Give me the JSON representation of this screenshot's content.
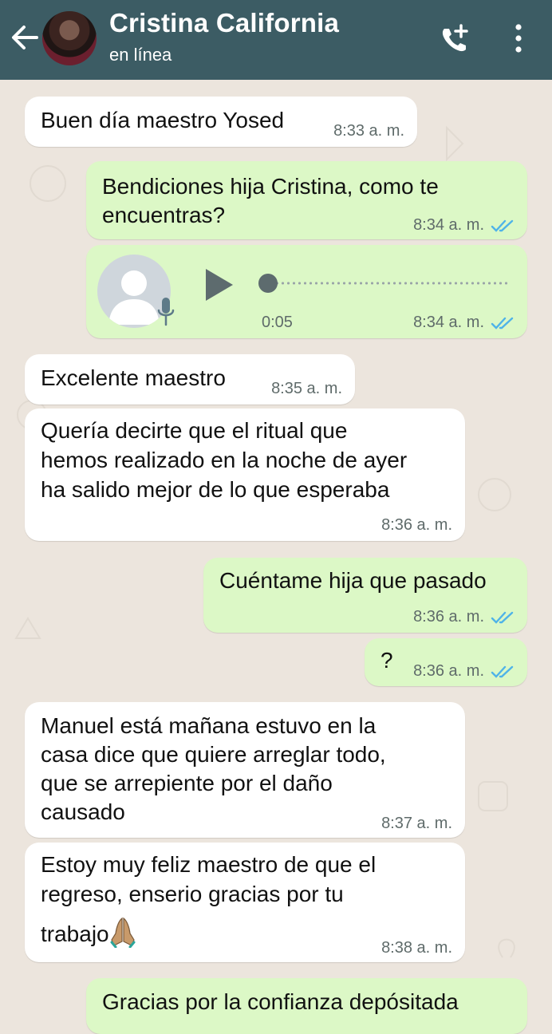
{
  "header": {
    "contact_name": "Cristina California",
    "status": "en línea",
    "background_color": "#3c5c64",
    "icons": [
      "back-arrow-icon",
      "add-call-icon",
      "more-options-icon"
    ]
  },
  "messages": [
    {
      "direction": "in",
      "text_lines": [
        "Buen día maestro Yosed"
      ],
      "time": "8:33 a. m."
    },
    {
      "direction": "out",
      "text_lines": [
        "Bendiciones hija Cristina, como te",
        "encuentras?"
      ],
      "time": "8:34 a. m.",
      "read": true
    },
    {
      "direction": "out",
      "type": "voice",
      "duration": "0:05",
      "time": "8:34 a. m.",
      "read": true,
      "progress": 0
    },
    {
      "direction": "in",
      "text_lines": [
        "Excelente maestro"
      ],
      "time": "8:35 a. m."
    },
    {
      "direction": "in",
      "text_lines": [
        "Quería decirte que el ritual que",
        "hemos realizado en la noche de ayer",
        "ha salido mejor de lo que esperaba"
      ],
      "time": "8:36 a. m."
    },
    {
      "direction": "out",
      "text_lines": [
        "Cuéntame hija que pasado"
      ],
      "time": "8:36 a. m.",
      "read": true
    },
    {
      "direction": "out",
      "text_lines": [
        "?"
      ],
      "time": "8:36 a. m.",
      "read": true
    },
    {
      "direction": "in",
      "text_lines": [
        "Manuel está mañana estuvo en la",
        "casa dice que quiere arreglar todo,",
        "que se arrepiente por el daño",
        "causado"
      ],
      "time": "8:37 a. m."
    },
    {
      "direction": "in",
      "text_lines": [
        "Estoy muy feliz maestro de que el",
        "regreso, enserio gracias por tu",
        "trabajo"
      ],
      "emoji": "🙏🏽",
      "time": "8:38 a. m."
    },
    {
      "direction": "out",
      "text_lines": [
        "Gracias por la confianza depósitada"
      ]
    }
  ],
  "colors": {
    "incoming_bubble": "#ffffff",
    "outgoing_bubble": "#dcf8c6",
    "read_ticks": "#4fb3e8",
    "chat_background": "#ece5dd"
  }
}
